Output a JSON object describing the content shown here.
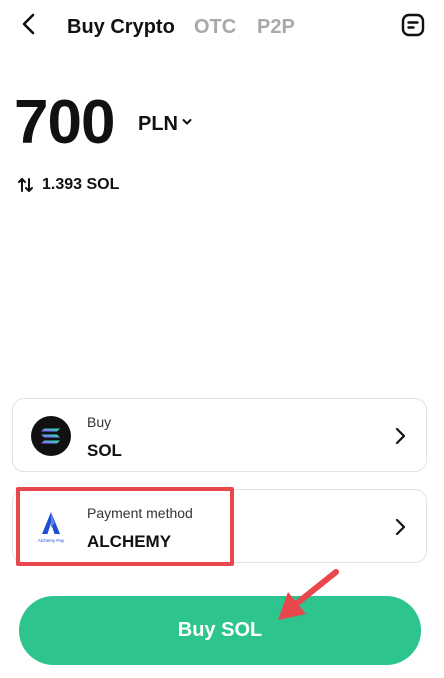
{
  "header": {
    "back_icon": "chevron-left-icon",
    "tabs": [
      {
        "label": "Buy Crypto",
        "active": true
      },
      {
        "label": "OTC",
        "active": false
      },
      {
        "label": "P2P",
        "active": false
      }
    ],
    "orders_icon": "orders-icon"
  },
  "amount": {
    "value": "700",
    "currency": "PLN",
    "converted": "1.393 SOL"
  },
  "buy_card": {
    "label": "Buy",
    "value": "SOL",
    "icon": "solana-logo"
  },
  "payment_card": {
    "label": "Payment method",
    "value": "ALCHEMY",
    "icon": "alchemy-pay-logo",
    "logo_text": "Alchemy Pay"
  },
  "action": {
    "buy_label": "Buy SOL"
  },
  "colors": {
    "accent": "#2dc48d",
    "annotation": "#e8474c",
    "inactive_tab": "#a8a8a8"
  }
}
